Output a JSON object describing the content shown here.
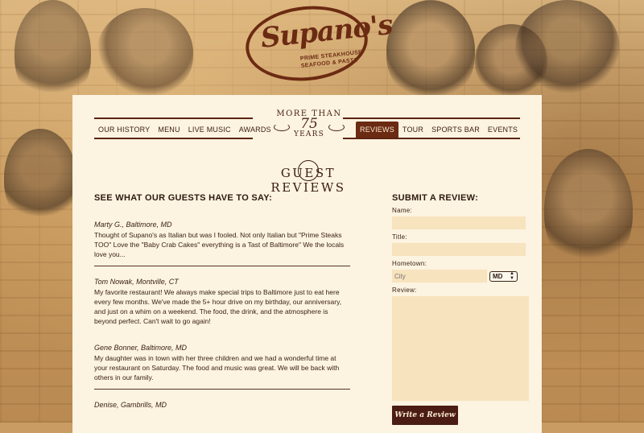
{
  "logo": {
    "script": "Supano's",
    "tagline_1": "PRIME STEAKHOUSE",
    "tagline_2": "SEAFOOD & PASTA"
  },
  "nav": {
    "left": [
      "OUR HISTORY",
      "MENU",
      "LIVE MUSIC",
      "AWARDS"
    ],
    "right": [
      "REVIEWS",
      "TOUR",
      "SPORTS BAR",
      "EVENTS"
    ],
    "active": "REVIEWS"
  },
  "badge": {
    "top": "MORE THAN",
    "number": "75",
    "bottom": "YEARS"
  },
  "section_title": "GUEST REVIEWS",
  "reviews_heading": "SEE WHAT OUR GUESTS HAVE TO SAY:",
  "reviews": [
    {
      "author": "Marty G., Baltimore, MD",
      "text": "Thought of Supano's as Italian but was I fooled. Not only Italian but \"Prime Steaks TOO\" Love the \"Baby Crab Cakes\" everything is a Tast of Baltimore\" We the locals love you..."
    },
    {
      "author": "Tom Nowak, Montville, CT",
      "text": "My favorite restaurant! We always make special trips to Baltimore just to eat here every few months. We've made the 5+ hour drive on my birthday, our anniversary, and just on a whim on a weekend. The food, the drink, and the atmosphere is beyond perfect. Can't wait to go again!"
    },
    {
      "author": "Gene Bonner, Baltimore, MD",
      "text": "My daughter was in town with her three children and we had a wonderful time at your restaurant on Saturday. The food and music was great. We will be back with others in our family."
    },
    {
      "author": "Denise, Gambrills, MD",
      "text": ""
    }
  ],
  "form": {
    "heading": "SUBMIT A REVIEW:",
    "name_label": "Name:",
    "title_label": "Title:",
    "hometown_label": "Hometown:",
    "city_placeholder": "City",
    "state_value": "MD",
    "review_label": "Review:",
    "submit_label": "Write a Review"
  }
}
